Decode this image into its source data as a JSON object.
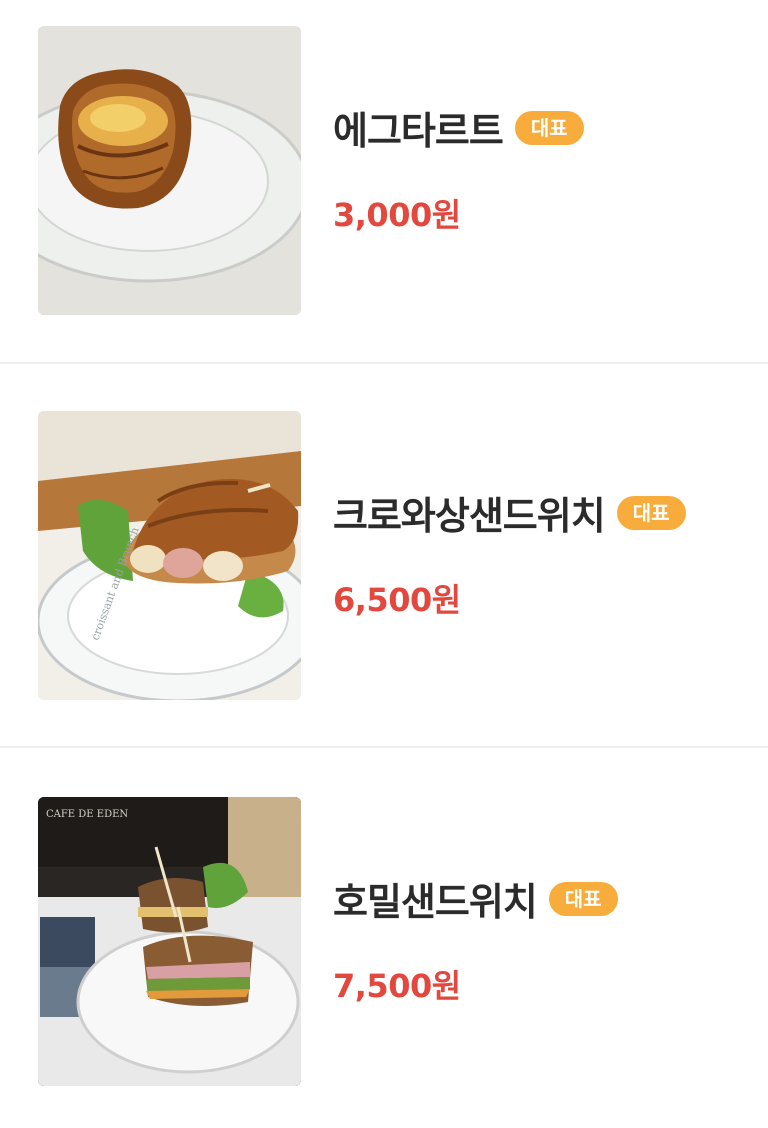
{
  "menu": {
    "items": [
      {
        "name": "에그타르트",
        "badge": "대표",
        "price": "3,000원",
        "image": "egg-tart-photo"
      },
      {
        "name": "크로와상샌드위치",
        "badge": "대표",
        "price": "6,500원",
        "image": "croissant-sandwich-photo",
        "plate_text": "croissant and Brunch"
      },
      {
        "name": "호밀샌드위치",
        "badge": "대표",
        "price": "7,500원",
        "image": "rye-sandwich-photo",
        "sign_text": "CAFE DE EDEN"
      }
    ]
  },
  "colors": {
    "badge_bg": "#f7ac3b",
    "price": "#e2483d",
    "name": "#2b2b2b",
    "divider": "#eeeeee"
  }
}
